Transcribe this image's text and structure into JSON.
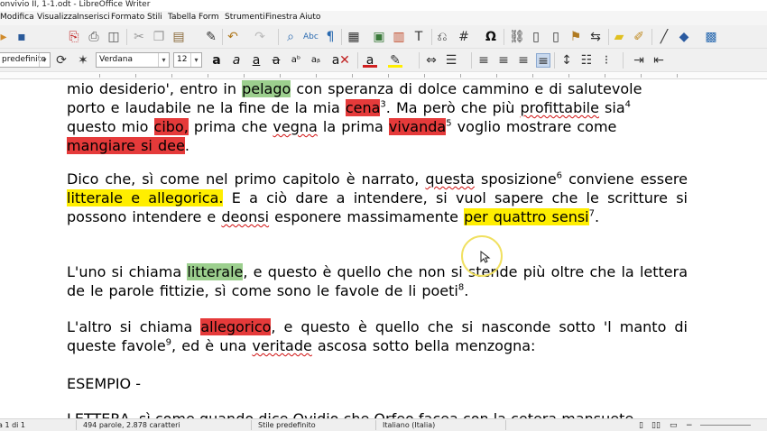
{
  "window": {
    "title": "onvivio II, 1-1.odt - LibreOffice Writer"
  },
  "menu": [
    "Modifica",
    "Visualizza",
    "Inserisci",
    "Formato",
    "Stili",
    "Tabella",
    "Form",
    "Strumenti",
    "Finestra",
    "Aiuto"
  ],
  "formatting": {
    "paragraph_style": "predefinito",
    "font_name": "Verdana",
    "font_size": "12"
  },
  "document": {
    "p0": {
      "l1a": "mio desiderio', entro in ",
      "l1b": "pelago",
      "l1c": " con speranza di dolce cammino e di salutevole",
      "l2a": "porto e laudabile ne la fine de la mia ",
      "l2b": "cena",
      "l2c": "3",
      "l2d": ". Ma però che più ",
      "l2e": "profittabile",
      "l2f": " sia",
      "l2g": "4",
      "l3a": "questo mio ",
      "l3b": "cibo,",
      "l3c": " prima che ",
      "l3d": "vegna",
      "l3e": " la prima ",
      "l3f": "vivanda",
      "l3g": "5",
      "l3h": " voglio mostrare come",
      "l4a": "mangiare si dee",
      "l4b": "."
    },
    "p1": {
      "a": "Dico che, sì come nel primo capitolo è narrato, ",
      "b": "questa",
      "c": " sposizione",
      "d": "6",
      "e": " conviene essere ",
      "f": "litterale e allegorica.",
      "g": " E a ciò dare a intendere, si vuol sapere che le scritture si possono intendere e ",
      "h": "deonsi",
      "i": " esponere massimamente ",
      "j": "per quattro sensi",
      "k": "7",
      "l": "."
    },
    "p2": {
      "a": "L'uno si chiama ",
      "b": "litterale",
      "c": ", e questo è quello che non si stende più oltre che la lettera de le parole fittizie, sì come sono le favole de li poeti",
      "d": "8",
      "e": "."
    },
    "p3": {
      "a": "L'altro si chiama ",
      "b": "allegorico",
      "c": ", e questo è quello che si nasconde sotto 'l manto di queste favole",
      "d": "9",
      "e": ", ed è una ",
      "f": "veritade",
      "g": " ascosa sotto bella menzogna:"
    },
    "p4": "ESEMPIO -",
    "p5": "LETTERA, sì come quando dice Ovidio che Orfeo facea con la cetera mansuete"
  },
  "status": {
    "page": "a 1 di 1",
    "words": "494 parole, 2.878 caratteri",
    "style": "Stile predefinito",
    "language": "Italiano (Italia)"
  },
  "colors": {
    "highlight_red": "#e53a3a",
    "highlight_yellow": "#ffee00",
    "highlight_green": "#9ccf8e"
  }
}
